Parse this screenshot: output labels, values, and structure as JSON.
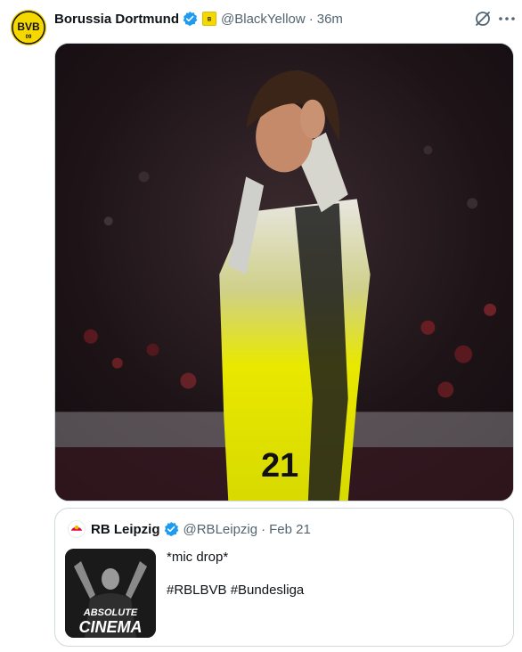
{
  "tweet": {
    "author_name": "Borussia Dortmund",
    "handle": "@BlackYellow",
    "separator": "·",
    "time": "36m",
    "avatar_icon": "bvb-crest",
    "avatar_text": "BVB",
    "avatar_number": "09",
    "verified_icon": "verified-badge",
    "affiliate_icon": "bvb-affiliate-badge",
    "grok_icon": "grok-icon",
    "more_icon": "more-icon",
    "media": {
      "description": "photo",
      "jersey_number": "21"
    }
  },
  "quoted": {
    "author_name": "RB Leipzig",
    "handle": "@RBLeipzig",
    "separator": "·",
    "date": "Feb 21",
    "avatar_icon": "rb-leipzig-logo",
    "verified_icon": "verified-badge",
    "text_line1": "*mic drop*",
    "text_line2": "#RBLBVB #Bundesliga",
    "thumbnail": {
      "caption_line1": "ABSOLUTE",
      "caption_line2": "CINEMA"
    }
  },
  "colors": {
    "accent_blue": "#1d9bf0",
    "bvb_yellow": "#f5d800",
    "text_primary": "#0f1419",
    "text_secondary": "#536471"
  }
}
